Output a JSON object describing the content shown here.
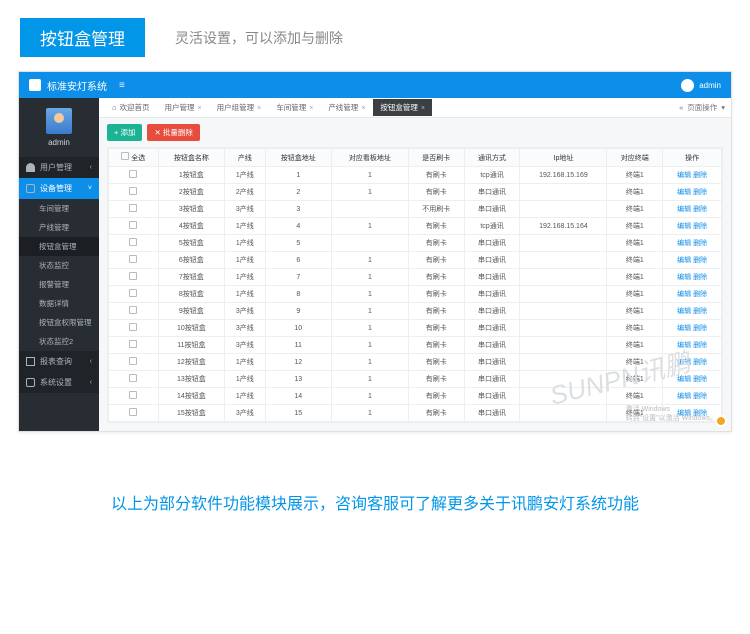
{
  "title_badge": "按钮盒管理",
  "title_desc": "灵活设置，可以添加与删除",
  "topbar": {
    "title": "标准安灯系统",
    "menu_icon": "≡",
    "user": "admin"
  },
  "sidebar": {
    "username": "admin",
    "groups": [
      {
        "icon": "user",
        "label": "用户管理",
        "open": false
      },
      {
        "icon": "gear",
        "label": "设备管理",
        "open": true,
        "subs": [
          "车间管理",
          "产线管理",
          "按钮盒管理",
          "状态监控",
          "报警管理",
          "数据详情",
          "按钮盒权限管理",
          "状态监控2"
        ]
      },
      {
        "icon": "report",
        "label": "报表查询",
        "open": false
      },
      {
        "icon": "gear",
        "label": "系统设置",
        "open": false
      }
    ]
  },
  "tabs": {
    "items": [
      {
        "label": "欢迎首页",
        "home": true
      },
      {
        "label": "用户管理"
      },
      {
        "label": "用户组管理"
      },
      {
        "label": "车间管理"
      },
      {
        "label": "产线管理"
      },
      {
        "label": "按钮盒管理",
        "active": true
      }
    ],
    "right_label": "页面操作",
    "right_icon": "▾"
  },
  "toolbar": {
    "add": "+ 添加",
    "del": "✕ 批量删除"
  },
  "table": {
    "headers": [
      "全选",
      "按钮盒名称",
      "产线",
      "按钮盒地址",
      "对应看板地址",
      "是否刷卡",
      "通讯方式",
      "Ip地址",
      "对应终端",
      "操作"
    ],
    "rows": [
      [
        "1按钮盒",
        "1产线",
        "1",
        "1",
        "有刷卡",
        "tcp通讯",
        "192.168.15.169",
        "终端1"
      ],
      [
        "2按钮盒",
        "2产线",
        "2",
        "1",
        "有刷卡",
        "串口通讯",
        "",
        "终端1"
      ],
      [
        "3按钮盒",
        "3产线",
        "3",
        "",
        "不用刷卡",
        "串口通讯",
        "",
        "终端1"
      ],
      [
        "4按钮盒",
        "1产线",
        "4",
        "1",
        "有刷卡",
        "tcp通讯",
        "192.168.15.164",
        "终端1"
      ],
      [
        "5按钮盒",
        "1产线",
        "5",
        "",
        "有刷卡",
        "串口通讯",
        "",
        "终端1"
      ],
      [
        "6按钮盒",
        "1产线",
        "6",
        "1",
        "有刷卡",
        "串口通讯",
        "",
        "终端1"
      ],
      [
        "7按钮盒",
        "1产线",
        "7",
        "1",
        "有刷卡",
        "串口通讯",
        "",
        "终端1"
      ],
      [
        "8按钮盒",
        "1产线",
        "8",
        "1",
        "有刷卡",
        "串口通讯",
        "",
        "终端1"
      ],
      [
        "9按钮盒",
        "3产线",
        "9",
        "1",
        "有刷卡",
        "串口通讯",
        "",
        "终端1"
      ],
      [
        "10按钮盒",
        "3产线",
        "10",
        "1",
        "有刷卡",
        "串口通讯",
        "",
        "终端1"
      ],
      [
        "11按钮盒",
        "3产线",
        "11",
        "1",
        "有刷卡",
        "串口通讯",
        "",
        "终端1"
      ],
      [
        "12按钮盒",
        "1产线",
        "12",
        "1",
        "有刷卡",
        "串口通讯",
        "",
        "终端1"
      ],
      [
        "13按钮盒",
        "1产线",
        "13",
        "1",
        "有刷卡",
        "串口通讯",
        "",
        "终端1"
      ],
      [
        "14按钮盒",
        "1产线",
        "14",
        "1",
        "有刷卡",
        "串口通讯",
        "",
        "终端1"
      ],
      [
        "15按钮盒",
        "3产线",
        "15",
        "1",
        "有刷卡",
        "串口通讯",
        "",
        "终端1"
      ]
    ],
    "op_edit": "编辑",
    "op_delete": "删除"
  },
  "watermark": "SUNPN讯鹏",
  "win_activate": {
    "line1": "激活 Windows",
    "line2": "转到\"设置\"以激活 Windows。"
  },
  "footer_note": "以上为部分软件功能模块展示，咨询客服可了解更多关于讯鹏安灯系统功能"
}
